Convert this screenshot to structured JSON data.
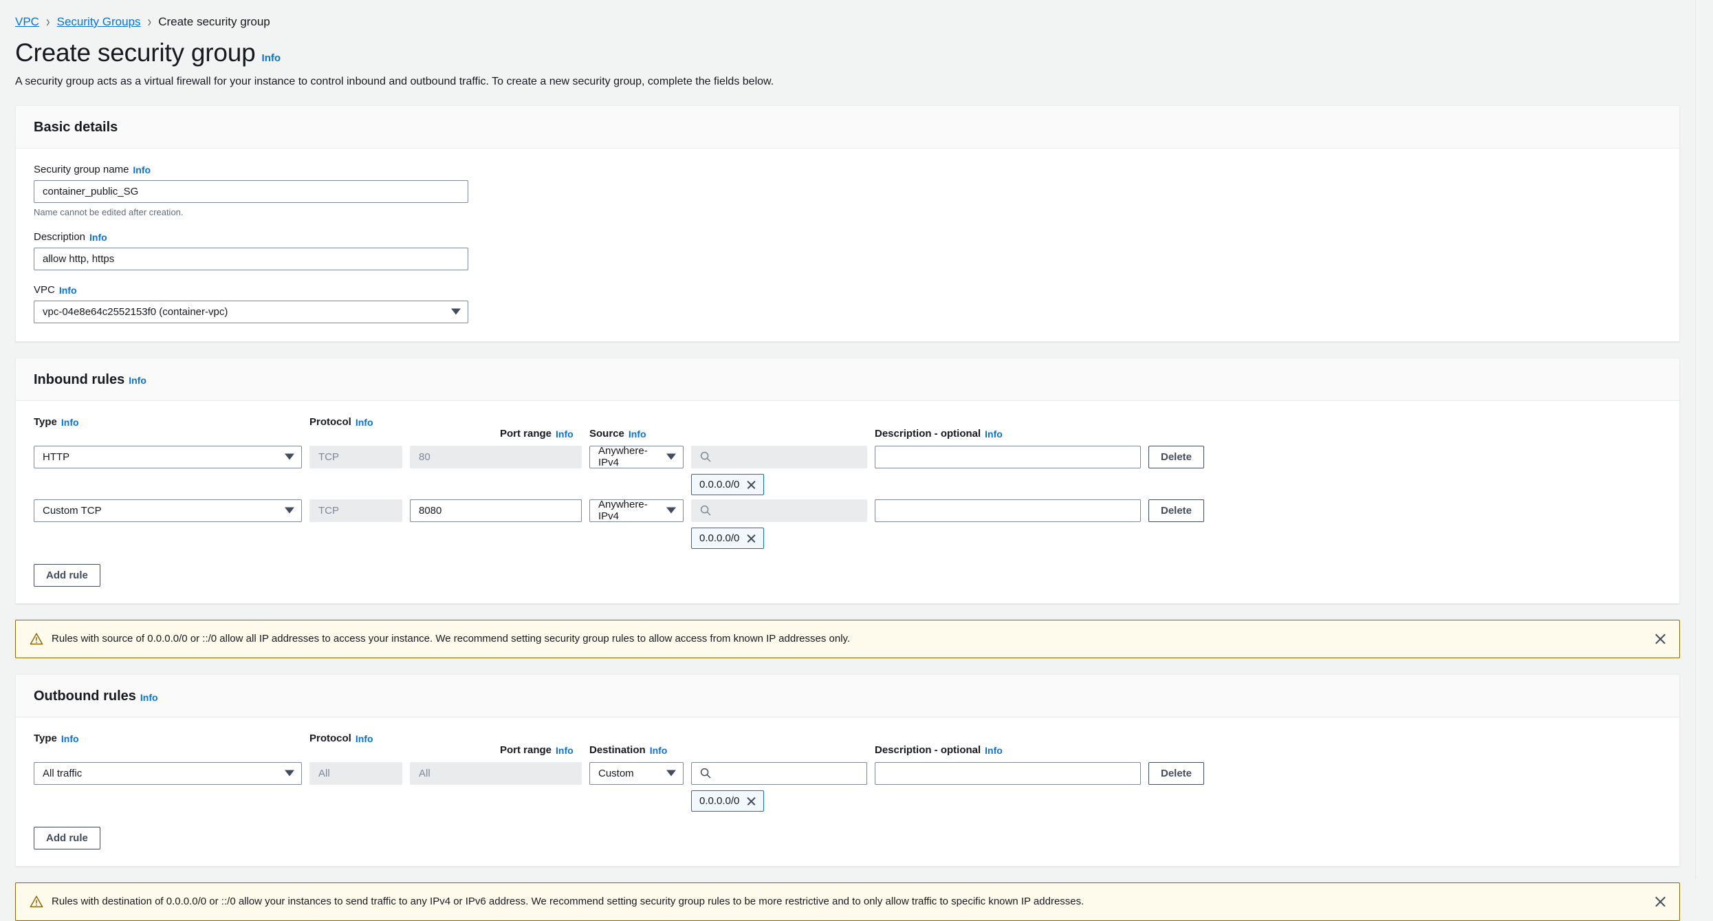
{
  "breadcrumb": {
    "items": [
      {
        "label": "VPC",
        "link": true
      },
      {
        "label": "Security Groups",
        "link": true
      },
      {
        "label": "Create security group",
        "link": false
      }
    ],
    "separator": "›"
  },
  "header": {
    "title": "Create security group",
    "info_label": "Info",
    "description": "A security group acts as a virtual firewall for your instance to control inbound and outbound traffic. To create a new security group, complete the fields below."
  },
  "basic_details": {
    "section_title": "Basic details",
    "name_field": {
      "label": "Security group name",
      "info_label": "Info",
      "value": "container_public_SG",
      "placeholder": "",
      "constraint": "Name cannot be edited after creation."
    },
    "description_field": {
      "label": "Description",
      "info_label": "Info",
      "value": "allow http, https",
      "placeholder": ""
    },
    "vpc_field": {
      "label": "VPC",
      "info_label": "Info",
      "value": "vpc-04e8e64c2552153f0 (container-vpc)"
    }
  },
  "inbound": {
    "section_title": "Inbound rules",
    "info_label": "Info",
    "columns": {
      "type": "Type",
      "protocol": "Protocol",
      "port_range": "Port range",
      "source": "Source",
      "description": "Description - optional",
      "info_label": "Info"
    },
    "rules": [
      {
        "type": "HTTP",
        "protocol": "TCP",
        "protocol_disabled": true,
        "port_range": "80",
        "port_disabled": true,
        "source_type": "Anywhere-IPv4",
        "source_search_value": "",
        "source_search_disabled": true,
        "token": "0.0.0.0/0",
        "description": "",
        "delete_label": "Delete"
      },
      {
        "type": "Custom TCP",
        "protocol": "TCP",
        "protocol_disabled": true,
        "port_range": "8080",
        "port_disabled": false,
        "source_type": "Anywhere-IPv4",
        "source_search_value": "",
        "source_search_disabled": true,
        "token": "0.0.0.0/0",
        "description": "",
        "delete_label": "Delete"
      }
    ],
    "add_rule_label": "Add rule"
  },
  "inbound_alert": {
    "text": "Rules with source of 0.0.0.0/0 or ::/0 allow all IP addresses to access your instance. We recommend setting security group rules to allow access from known IP addresses only.",
    "type": "warning",
    "border_color": "#8d6605",
    "background_color": "#fffbec"
  },
  "outbound": {
    "section_title": "Outbound rules",
    "info_label": "Info",
    "columns": {
      "type": "Type",
      "protocol": "Protocol",
      "port_range": "Port range",
      "destination": "Destination",
      "description": "Description - optional",
      "info_label": "Info"
    },
    "rules": [
      {
        "type": "All traffic",
        "protocol": "All",
        "protocol_disabled": true,
        "port_range": "All",
        "port_disabled": true,
        "destination_type": "Custom",
        "destination_search_value": "",
        "destination_search_disabled": false,
        "token": "0.0.0.0/0",
        "description": "",
        "delete_label": "Delete"
      }
    ],
    "add_rule_label": "Add rule"
  },
  "outbound_alert": {
    "text": "Rules with destination of 0.0.0.0/0 or ::/0 allow your instances to send traffic to any IPv4 or IPv6 address. We recommend setting security group rules to be more restrictive and to only allow traffic to specific known IP addresses.",
    "type": "warning",
    "border_color": "#8d6605",
    "background_color": "#fffbec"
  },
  "colors": {
    "link": "#0972d3",
    "page_background": "#f2f3f3",
    "panel_background": "#ffffff",
    "token_background": "#f2f8fd",
    "token_border": "#0972d3"
  }
}
